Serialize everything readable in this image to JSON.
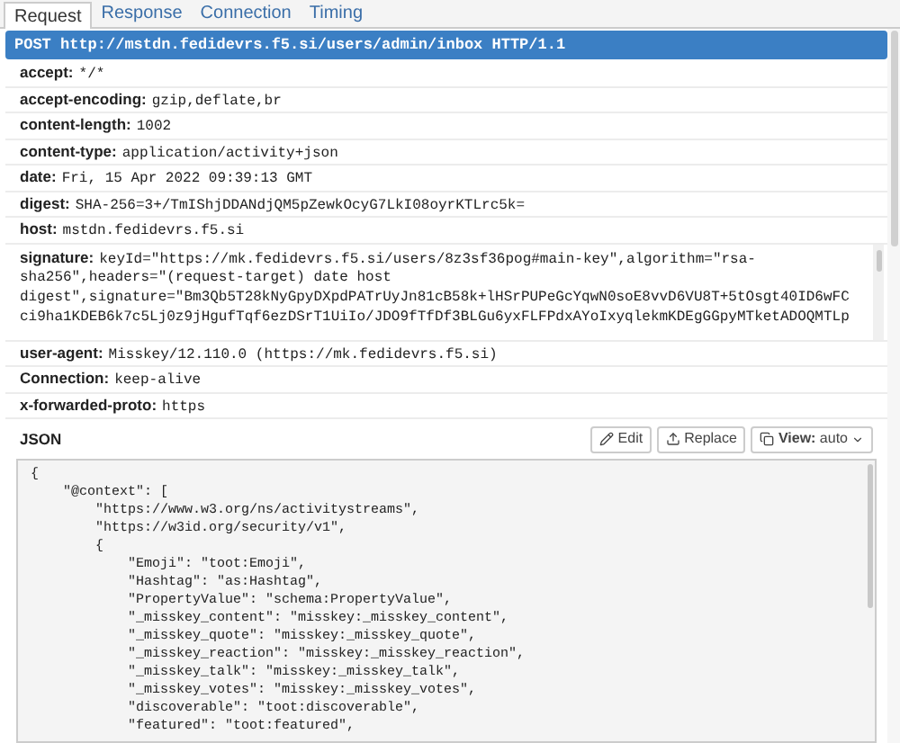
{
  "tabs": [
    {
      "label": "Request",
      "selected": true
    },
    {
      "label": "Response",
      "selected": false
    },
    {
      "label": "Connection",
      "selected": false
    },
    {
      "label": "Timing",
      "selected": false
    }
  ],
  "request_line": "POST http://mstdn.fedidevrs.f5.si/users/admin/inbox HTTP/1.1",
  "headers_before": [
    {
      "name": "accept:",
      "value": "*/*"
    },
    {
      "name": "accept-encoding:",
      "value": "gzip,deflate,br"
    },
    {
      "name": "content-length:",
      "value": "1002"
    },
    {
      "name": "content-type:",
      "value": "application/activity+json"
    },
    {
      "name": "date:",
      "value": "Fri, 15 Apr 2022 09:39:13 GMT"
    },
    {
      "name": "digest:",
      "value": "SHA-256=3+/TmIShjDDANdjQM5pZewkOcyG7LkI08oyrKTLrc5k="
    },
    {
      "name": "host:",
      "value": "mstdn.fedidevrs.f5.si"
    }
  ],
  "signature": {
    "name": "signature:",
    "lines": [
      "keyId=\"https://mk.fedidevrs.f5.si/users/8z3sf36pog#main-key\",algorithm=\"rsa-",
      "sha256\",headers=\"(request-target) date host",
      "digest\",signature=\"Bm3Qb5T28kNyGpyDXpdPATrUyJn81cB58k+lHSrPUPeGcYqwN0soE8vvD6VU8T+5tOsgt40ID6wFC",
      "ci9ha1KDEB6k7c5Lj0z9jHgufTqf6ezDSrT1UiIo/JDO9fTfDf3BLGu6yxFLFPdxAYoIxyqlekmKDEgGGpyMTketADOQMTLp"
    ]
  },
  "headers_after": [
    {
      "name": "user-agent:",
      "value": "Misskey/12.110.0 (https://mk.fedidevrs.f5.si)"
    },
    {
      "name": "Connection:",
      "value": "keep-alive"
    },
    {
      "name": "x-forwarded-proto:",
      "value": "https"
    }
  ],
  "body": {
    "title": "JSON",
    "buttons": [
      {
        "kind": "edit",
        "label": "Edit"
      },
      {
        "kind": "replace",
        "label": "Replace"
      },
      {
        "kind": "view",
        "label": "**View:** auto"
      }
    ],
    "lines": [
      "{",
      "    \"@context\": [",
      "        \"https://www.w3.org/ns/activitystreams\",",
      "        \"https://w3id.org/security/v1\",",
      "        {",
      "            \"Emoji\": \"toot:Emoji\",",
      "            \"Hashtag\": \"as:Hashtag\",",
      "            \"PropertyValue\": \"schema:PropertyValue\",",
      "            \"_misskey_content\": \"misskey:_misskey_content\",",
      "            \"_misskey_quote\": \"misskey:_misskey_quote\",",
      "            \"_misskey_reaction\": \"misskey:_misskey_reaction\",",
      "            \"_misskey_talk\": \"misskey:_misskey_talk\",",
      "            \"_misskey_votes\": \"misskey:_misskey_votes\",",
      "            \"discoverable\": \"toot:discoverable\",",
      "            \"featured\": \"toot:featured\","
    ]
  }
}
